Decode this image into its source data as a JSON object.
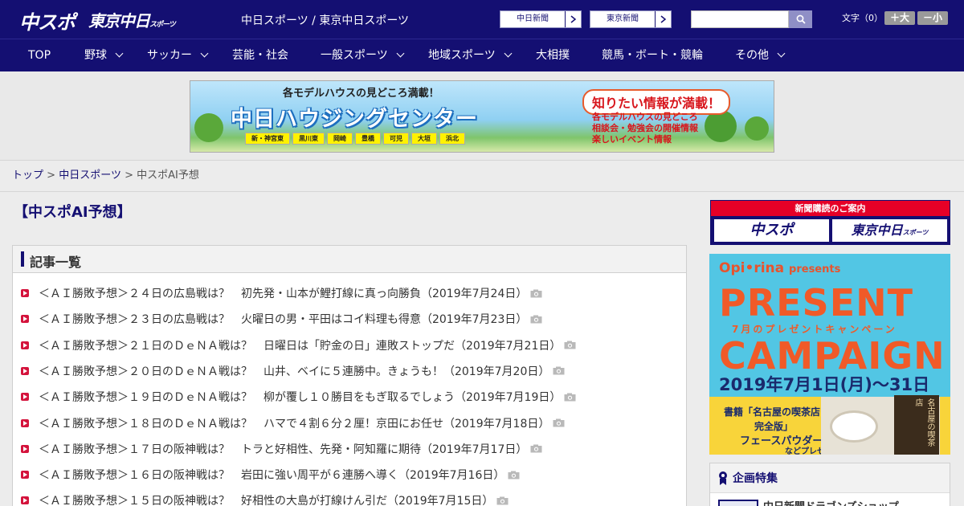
{
  "header": {
    "logo_primary": "中スポ",
    "logo_secondary": "東京中日",
    "logo_secondary_small": "スポーツ",
    "site_title": "中日スポーツ / 東京中日スポーツ",
    "ext_links": [
      "中日新聞",
      "東京新聞"
    ],
    "search": {
      "value": "",
      "placeholder": ""
    },
    "font_size_label": "文字（0）",
    "font_larger": "＋大",
    "font_smaller": "－小",
    "colors": {
      "header_bg": "#140f72",
      "accent_red": "#d4133c"
    }
  },
  "nav": {
    "items": [
      {
        "label": "TOP",
        "dropdown": false
      },
      {
        "label": "野球",
        "dropdown": true
      },
      {
        "label": "サッカー",
        "dropdown": true
      },
      {
        "label": "芸能・社会",
        "dropdown": false
      },
      {
        "label": "一般スポーツ",
        "dropdown": true
      },
      {
        "label": "地域スポーツ",
        "dropdown": true
      },
      {
        "label": "大相撲",
        "dropdown": false
      },
      {
        "label": "競馬・ボート・競輪",
        "dropdown": false
      },
      {
        "label": "その他",
        "dropdown": true
      }
    ]
  },
  "banner": {
    "subtitle": "各モデルハウスの見どころ満載！",
    "title": "中日ハウジングセンター",
    "places": [
      "新・神宮東",
      "黒川東",
      "岡崎",
      "豊橋",
      "可児",
      "大垣",
      "浜北"
    ],
    "headline": "知りたい情報が満載！",
    "lines": [
      "各モデルハウスの見どころ",
      "相談会・勉強会の開催情報",
      "楽しいイベント情報"
    ]
  },
  "breadcrumb": {
    "items": [
      "トップ",
      "中日スポーツ",
      "中スポAI予想"
    ],
    "separator": ">"
  },
  "main": {
    "page_title": "【中スポAI予想】",
    "list_header": "記事一覧",
    "articles": [
      "＜ＡＩ勝敗予想＞２４日の広島戦は？　初先発・山本が鯉打線に真っ向勝負（2019年7月24日）",
      "＜ＡＩ勝敗予想＞２３日の広島戦は？　火曜日の男・平田はコイ料理も得意（2019年7月23日）",
      "＜ＡＩ勝敗予想＞２１日のＤｅＮＡ戦は？　日曜日は「貯金の日」連敗ストップだ（2019年7月21日）",
      "＜ＡＩ勝敗予想＞２０日のＤｅＮＡ戦は？　山井、ベイに５連勝中。きょうも！（2019年7月20日）",
      "＜ＡＩ勝敗予想＞１９日のＤｅＮＡ戦は？　柳が覆し１０勝目をもぎ取るでしょう（2019年7月19日）",
      "＜ＡＩ勝敗予想＞１８日のＤｅＮＡ戦は？　ハマで４割６分２厘！京田にお任せ（2019年7月18日）",
      "＜ＡＩ勝敗予想＞１７日の阪神戦は？　トラと好相性、先発・阿知羅に期待（2019年7月17日）",
      "＜ＡＩ勝敗予想＞１６日の阪神戦は？　岩田に強い周平が６連勝へ導く（2019年7月16日）",
      "＜ＡＩ勝敗予想＞１５日の阪神戦は？　好相性の大島が打線けん引だ（2019年7月15日）"
    ]
  },
  "sidebar": {
    "subscription_head": "新聞購読のご案内",
    "subscription_logos": [
      "中スポ",
      "東京中日"
    ],
    "subscription_logo_small": "スポーツ",
    "promo": {
      "brand": "Opi•rina",
      "brand_suffix": "presents",
      "line1": "PRESENT",
      "line2": "7月のプレゼントキャンペーン",
      "line3": "CAMPAIGN",
      "date": "2019年7月1日(月)〜31日(水)",
      "foot1": "書籍「名古屋の喫茶店",
      "foot2": "完全版」",
      "foot3": "フェースパウダー",
      "foot4": "などプレゼント",
      "book_text": "名古屋の喫茶店"
    },
    "feature_head": "企画特集",
    "feature_item": "中日新聞ドラゴンズショップ"
  }
}
